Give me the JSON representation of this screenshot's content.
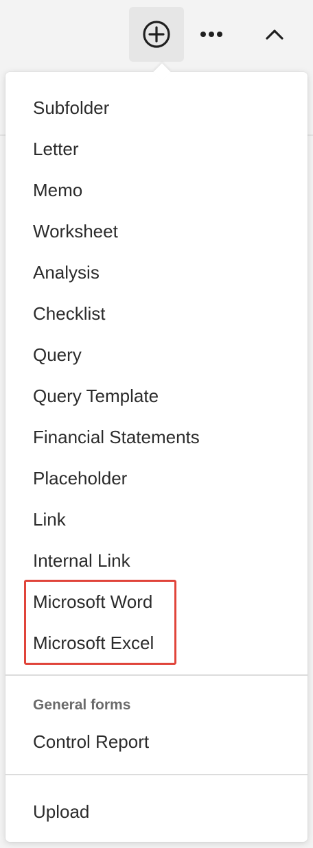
{
  "toolbar": {
    "add_icon": "plus-circle-icon",
    "more_icon": "ellipsis-icon",
    "collapse_icon": "chevron-up-icon"
  },
  "menu": {
    "items": [
      {
        "label": "Subfolder"
      },
      {
        "label": "Letter"
      },
      {
        "label": "Memo"
      },
      {
        "label": "Worksheet"
      },
      {
        "label": "Analysis"
      },
      {
        "label": "Checklist"
      },
      {
        "label": "Query"
      },
      {
        "label": "Query Template"
      },
      {
        "label": "Financial Statements"
      },
      {
        "label": "Placeholder"
      },
      {
        "label": "Link"
      },
      {
        "label": "Internal Link"
      },
      {
        "label": "Microsoft Word"
      },
      {
        "label": "Microsoft Excel"
      }
    ],
    "general_forms": {
      "heading": "General forms",
      "items": [
        {
          "label": "Control Report"
        }
      ]
    },
    "upload_label": "Upload"
  },
  "colors": {
    "highlight": "#e0443a",
    "active_button_bg": "#e6e6e6"
  }
}
